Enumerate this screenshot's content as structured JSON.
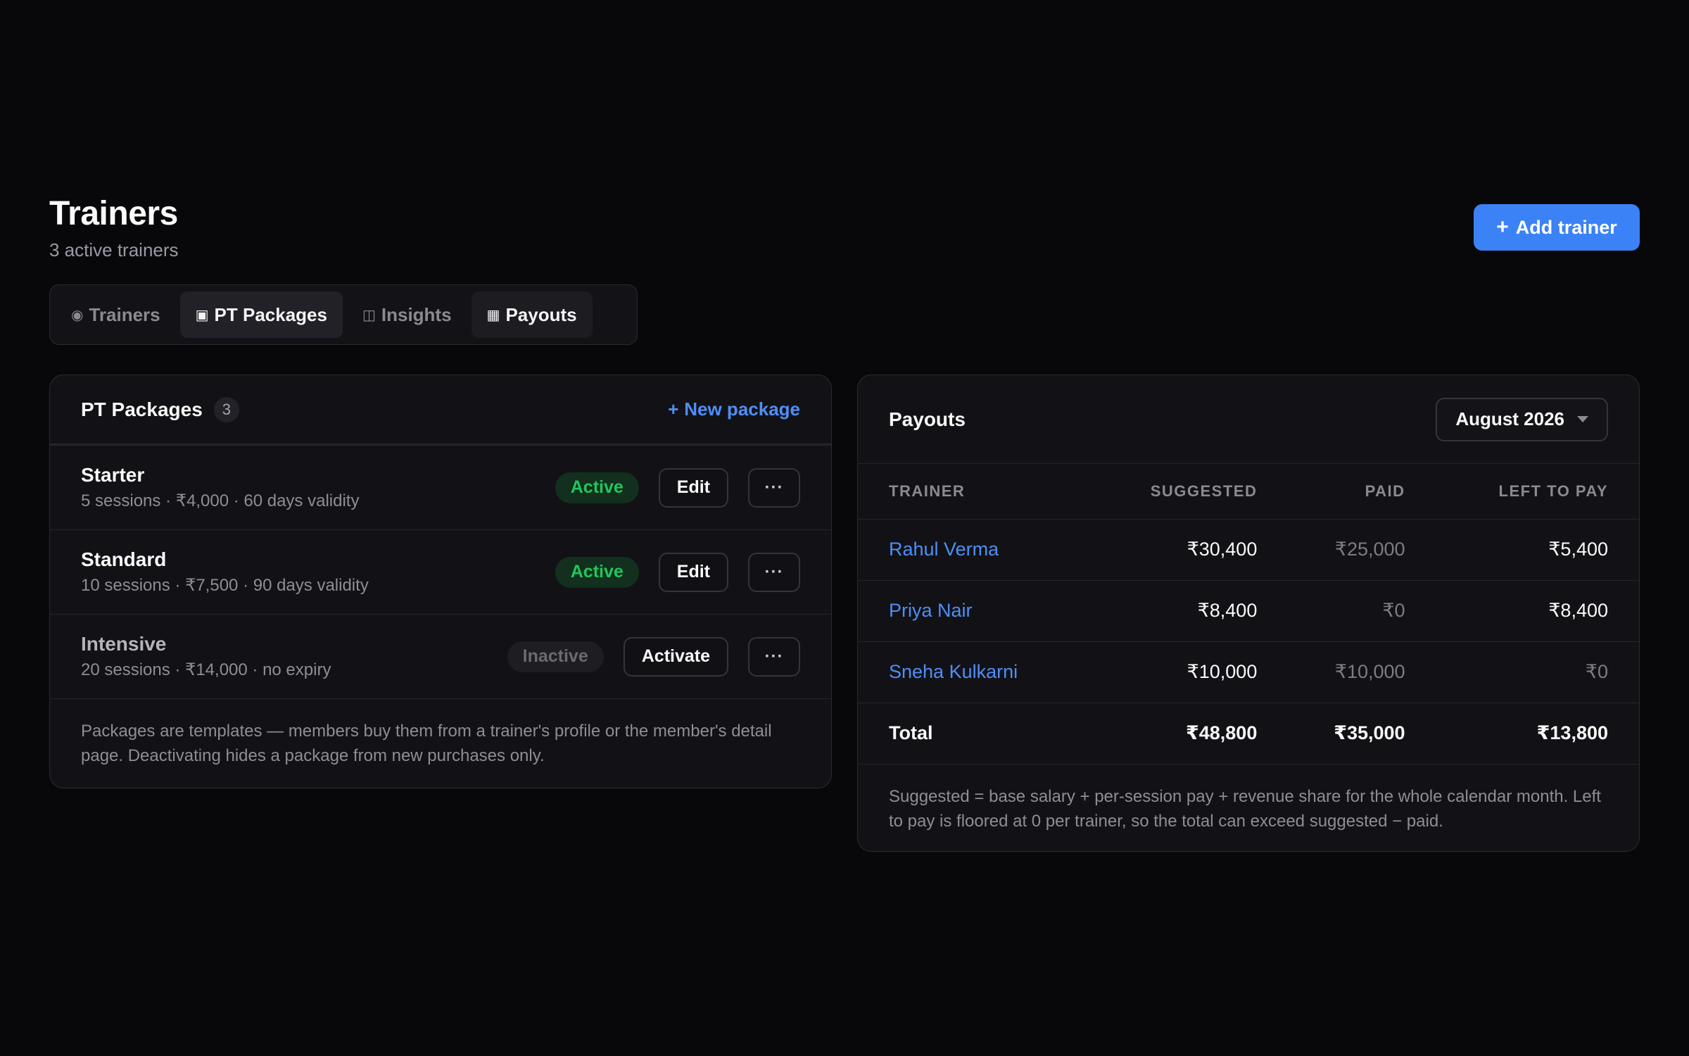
{
  "header": {
    "title": "Trainers",
    "subtitle": "3 active trainers",
    "add_button_icon": "+",
    "add_button_label": "Add trainer"
  },
  "tabs": [
    {
      "icon": "◉",
      "label": "Trainers",
      "state": "inactive"
    },
    {
      "icon": "▣",
      "label": "PT Packages",
      "state": "active"
    },
    {
      "icon": "◫",
      "label": "Insights",
      "state": "inactive"
    },
    {
      "icon": "▦",
      "label": "Payouts",
      "state": "active"
    }
  ],
  "packages": {
    "title": "PT Packages",
    "count": "3",
    "new_icon": "+",
    "new_label": "New package",
    "items": [
      {
        "name": "Starter",
        "desc": "5 sessions · ₹4,000 · 60 days validity",
        "status": "Active",
        "action": "Edit",
        "more": "···"
      },
      {
        "name": "Standard",
        "desc": "10 sessions · ₹7,500 · 90 days validity",
        "status": "Active",
        "action": "Edit",
        "more": "···"
      },
      {
        "name": "Intensive",
        "desc": "20 sessions · ₹14,000 · no expiry",
        "status": "Inactive",
        "action": "Activate",
        "more": "···"
      }
    ],
    "note": "Packages are templates — members buy them from a trainer's profile or the member's detail page. Deactivating hides a package from new purchases only."
  },
  "payouts": {
    "title": "Payouts",
    "month": "August 2026",
    "columns": [
      "TRAINER",
      "SUGGESTED",
      "PAID",
      "LEFT TO PAY"
    ],
    "rows": [
      {
        "trainer": "Rahul Verma",
        "suggested": "₹30,400",
        "paid": "₹25,000",
        "left": "₹5,400"
      },
      {
        "trainer": "Priya Nair",
        "suggested": "₹8,400",
        "paid": "₹0",
        "left": "₹8,400"
      },
      {
        "trainer": "Sneha Kulkarni",
        "suggested": "₹10,000",
        "paid": "₹10,000",
        "left": "₹0"
      }
    ],
    "total": {
      "label": "Total",
      "suggested": "₹48,800",
      "paid": "₹35,000",
      "left": "₹13,800"
    },
    "note": "Suggested = base salary + per-session pay + revenue share for the whole calendar month. Left to pay is floored at 0 per trainer, so the total can exceed suggested − paid."
  },
  "colors": {
    "background": "#08080b",
    "accent": "#3b82f6",
    "link": "#4f8ef7",
    "active_status": "#22c55e"
  }
}
